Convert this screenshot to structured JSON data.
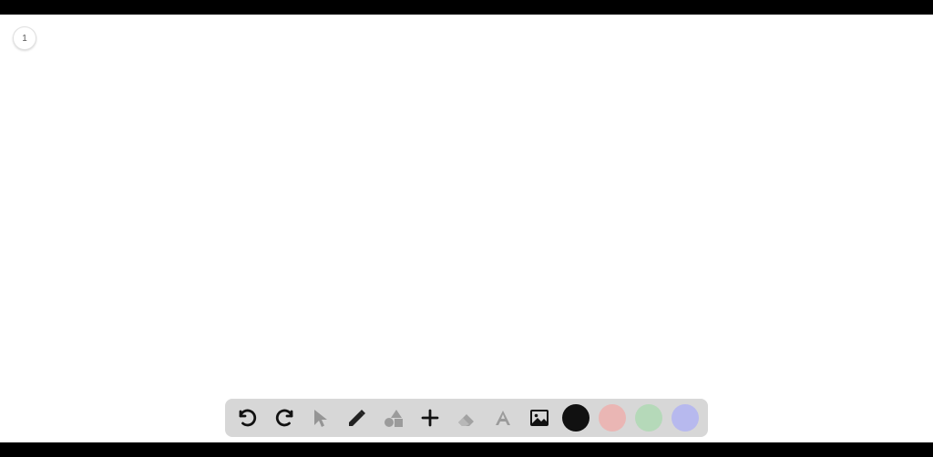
{
  "page": {
    "number": "1"
  },
  "toolbar": {
    "tools": [
      {
        "id": "undo"
      },
      {
        "id": "redo"
      },
      {
        "id": "select"
      },
      {
        "id": "pencil"
      },
      {
        "id": "shapes"
      },
      {
        "id": "plus"
      },
      {
        "id": "eraser"
      },
      {
        "id": "text"
      },
      {
        "id": "image"
      }
    ],
    "colors": [
      {
        "id": "black",
        "hex": "#111111"
      },
      {
        "id": "pink",
        "hex": "#eab6b4"
      },
      {
        "id": "green",
        "hex": "#b5d9b9"
      },
      {
        "id": "purple",
        "hex": "#b7b9ee"
      }
    ]
  }
}
